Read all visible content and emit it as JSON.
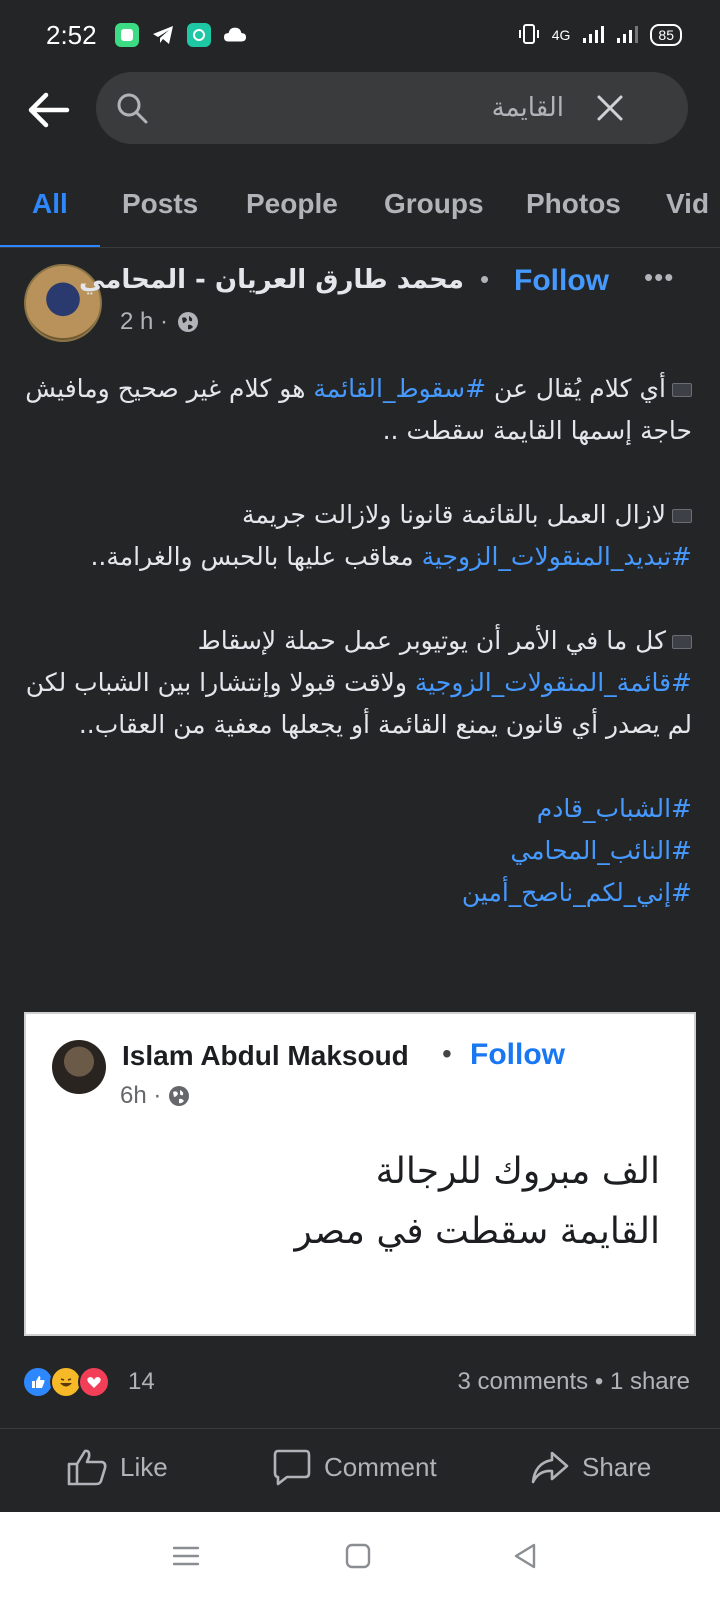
{
  "status": {
    "time": "2:52",
    "network": "4G",
    "battery": "85"
  },
  "search": {
    "value": "القايمة"
  },
  "tabs": [
    "All",
    "Posts",
    "People",
    "Groups",
    "Photos",
    "Vid"
  ],
  "post": {
    "author": "محمد طارق العريان - المحامي",
    "follow": "Follow",
    "time": "2 h ·",
    "p1": {
      "pre": "أي كلام يُقال عن ",
      "tag": "#سقوط_القائمة",
      "post": " هو كلام غير صحيح ومافيش حاجة إسمها القايمة سقطت .."
    },
    "p2": {
      "pre": "لازال العمل بالقائمة قانونا ولازالت جريمة ",
      "tag": "#تبديد_المنقولات_الزوجية",
      "post": " معاقب عليها بالحبس والغرامة.."
    },
    "p3": {
      "pre": "كل ما في الأمر أن يوتيوبر عمل حملة لإسقاط ",
      "tag": "#قائمة_المنقولات_الزوجية",
      "post": " ولاقت قبولا وإنتشارا بين الشباب لكن لم يصدر أي قانون يمنع القائمة أو يجعلها معفية من العقاب.."
    },
    "tags": [
      "#الشباب_قادم",
      "#النائب_المحامي",
      "#إني_لكم_ناصح_أمين"
    ]
  },
  "shared": {
    "author": "Islam Abdul Maksoud",
    "follow": "Follow",
    "time": "6h ·",
    "line1": "الف مبروك للرجالة",
    "line2": "القايمة سقطت في مصر"
  },
  "reactions": {
    "count": "14",
    "comments": "3 comments",
    "shares": "1 share",
    "sep": " • "
  },
  "actions": {
    "like": "Like",
    "comment": "Comment",
    "share": "Share"
  },
  "colors": {
    "accent": "#2d88ff",
    "background": "#242527"
  }
}
